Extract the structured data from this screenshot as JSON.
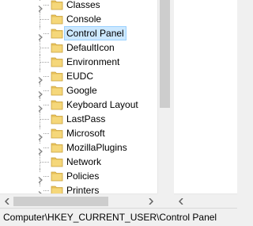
{
  "tree": {
    "items": [
      {
        "label": "Classes",
        "expandable": true,
        "selected": false
      },
      {
        "label": "Console",
        "expandable": false,
        "selected": false
      },
      {
        "label": "Control Panel",
        "expandable": true,
        "selected": true
      },
      {
        "label": "DefaultIcon",
        "expandable": false,
        "selected": false
      },
      {
        "label": "Environment",
        "expandable": false,
        "selected": false
      },
      {
        "label": "EUDC",
        "expandable": true,
        "selected": false
      },
      {
        "label": "Google",
        "expandable": true,
        "selected": false
      },
      {
        "label": "Keyboard Layout",
        "expandable": true,
        "selected": false
      },
      {
        "label": "LastPass",
        "expandable": false,
        "selected": false
      },
      {
        "label": "Microsoft",
        "expandable": true,
        "selected": false
      },
      {
        "label": "MozillaPlugins",
        "expandable": true,
        "selected": false
      },
      {
        "label": "Network",
        "expandable": false,
        "selected": false
      },
      {
        "label": "Policies",
        "expandable": true,
        "selected": false
      },
      {
        "label": "Printers",
        "expandable": true,
        "selected": false
      }
    ]
  },
  "status": {
    "path": "Computer\\HKEY_CURRENT_USER\\Control Panel"
  },
  "colors": {
    "folder": "#e8c25a",
    "selection_bg": "#cce8ff",
    "selection_border": "#99d1ff"
  },
  "icons": {
    "folder": "folder-icon",
    "expand": "chevron-right-icon"
  }
}
